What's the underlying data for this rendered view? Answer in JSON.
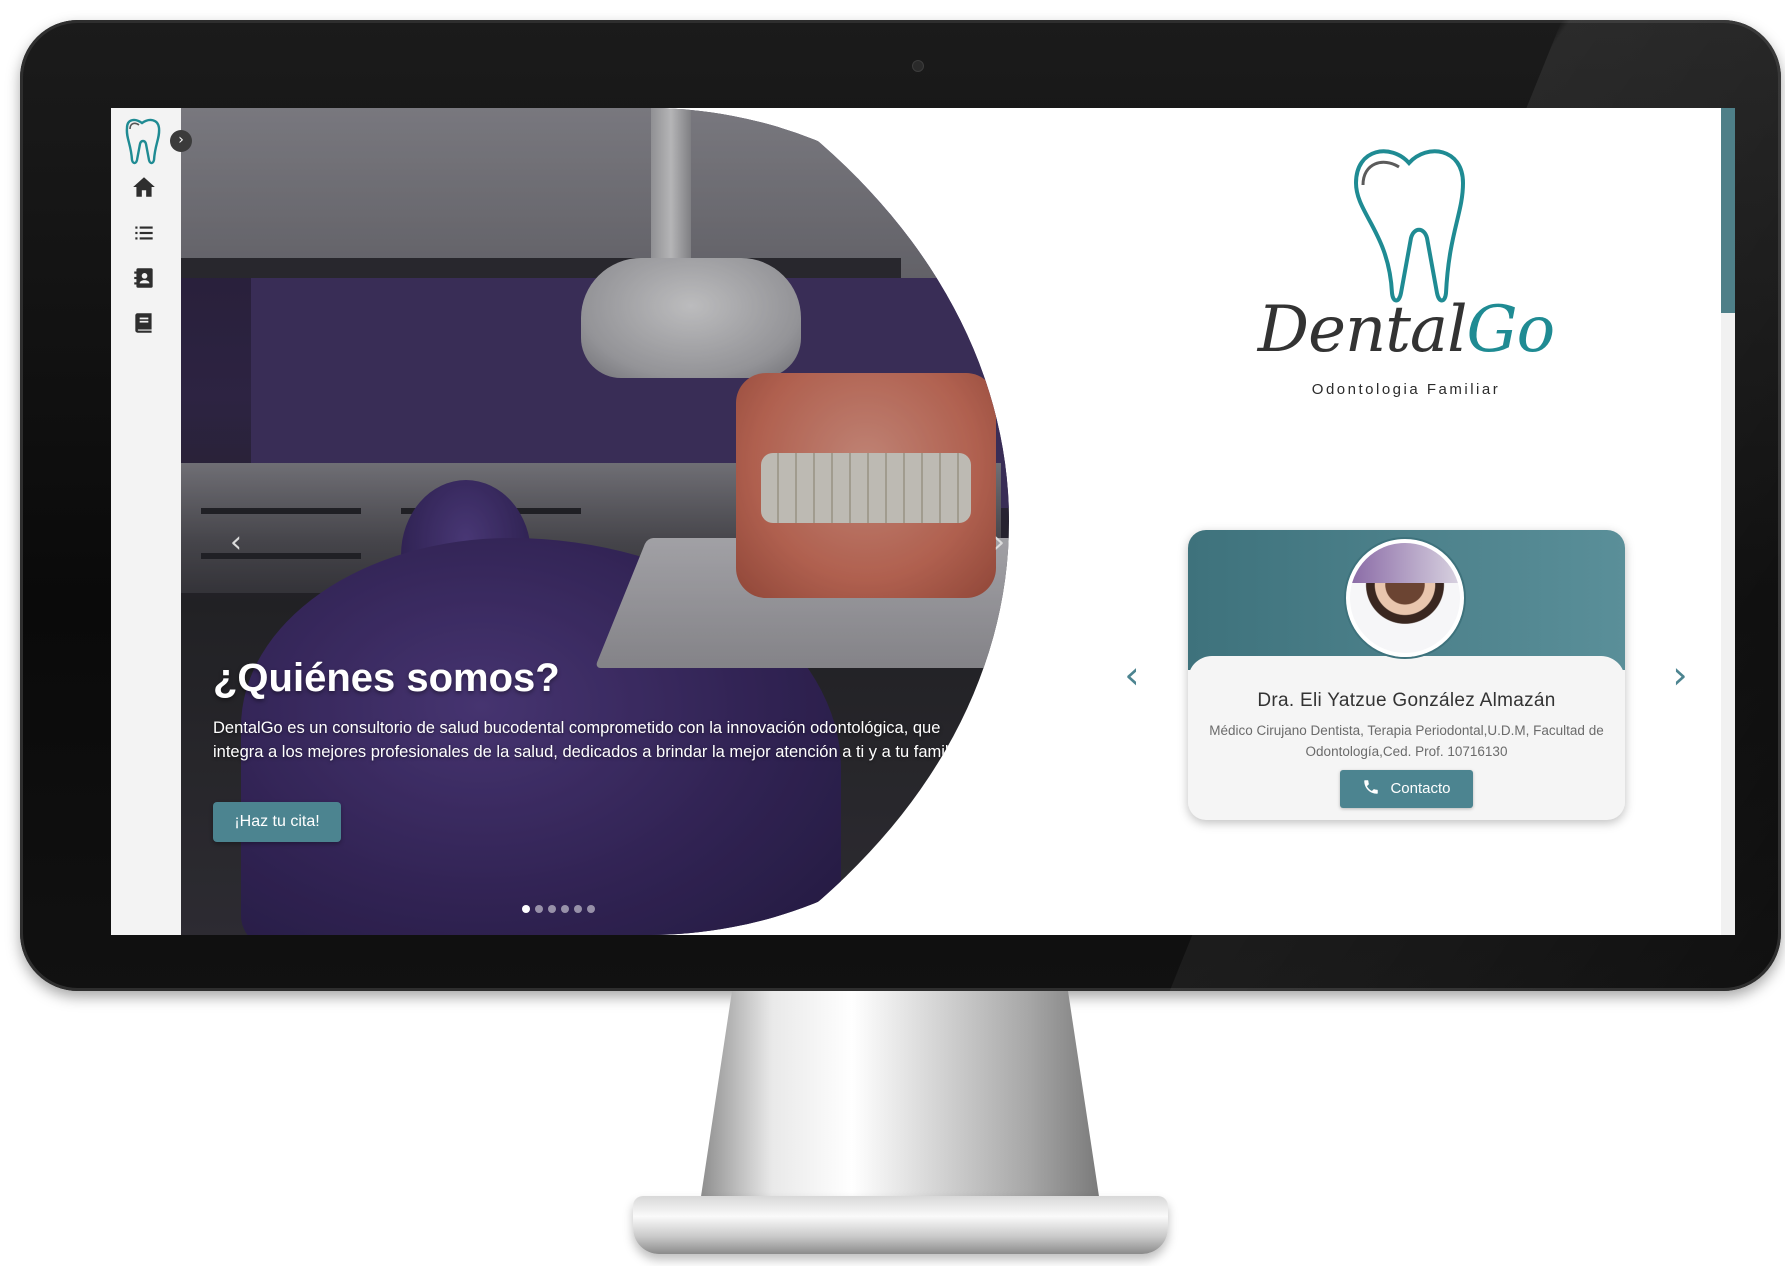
{
  "brand": {
    "name_part1": "Dental",
    "name_part2": "Go",
    "tagline": "Odontologia Familiar",
    "accent_color": "#1f8b93",
    "primary_color": "#4c8490"
  },
  "sidebar": {
    "toggle_glyph": "›",
    "items": [
      {
        "icon": "home-icon"
      },
      {
        "icon": "list-icon"
      },
      {
        "icon": "contact-book-icon"
      },
      {
        "icon": "book-icon"
      }
    ]
  },
  "hero": {
    "title": "¿Quiénes somos?",
    "text": "DentalGo es un consultorio de salud bucodental comprometido con la innovación odontológica, que integra a los mejores profesionales de la salud, dedicados a brindar la mejor atención a ti y a tu familia.",
    "cta_label": "¡Haz tu cita!",
    "prev_glyph": "‹",
    "next_glyph": "›",
    "slides_count": 6,
    "active_slide": 1
  },
  "doctor": {
    "name": "Dra. Eli Yatzue González Almazán",
    "credentials": "Médico Cirujano Dentista, Terapia Periodontal,U.D.M, Facultad de Odontología,Ced. Prof. 10716130",
    "contact_label": "Contacto",
    "prev_glyph": "‹",
    "next_glyph": "›"
  }
}
